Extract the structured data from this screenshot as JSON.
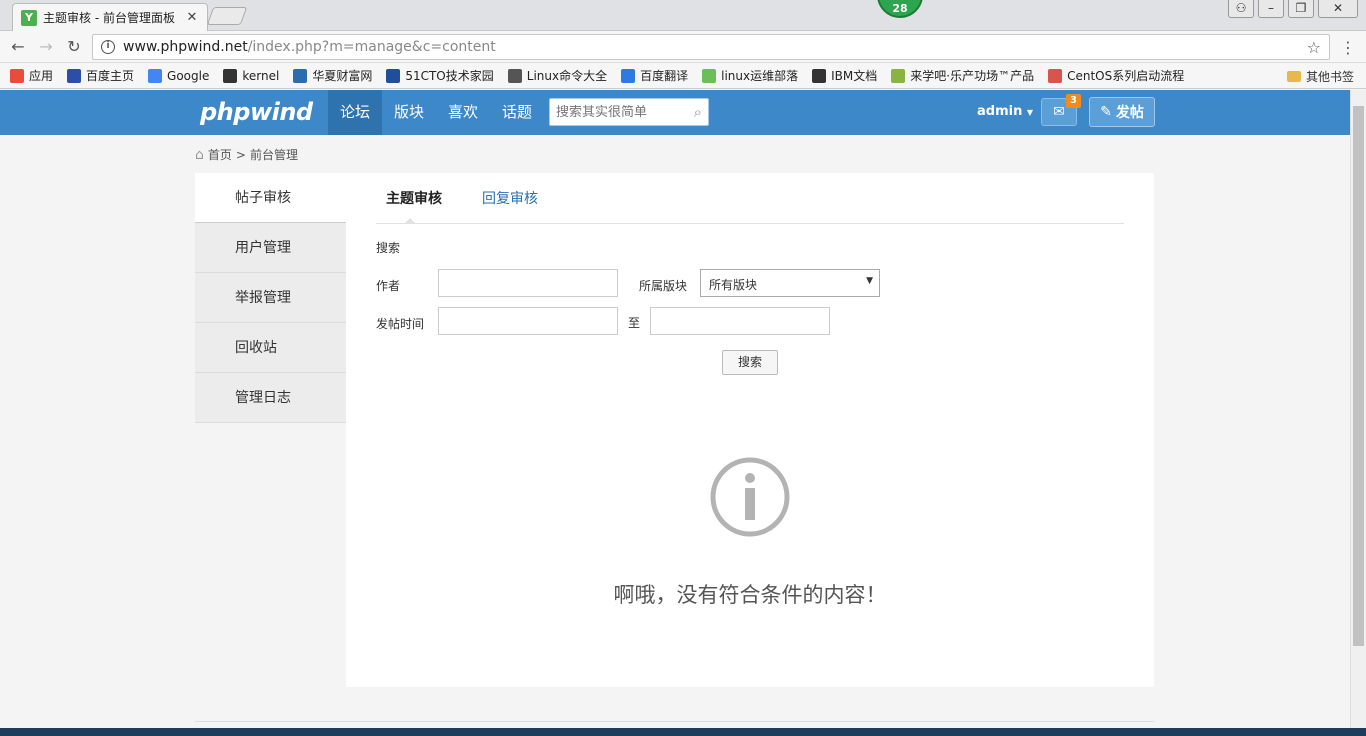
{
  "browser": {
    "tab_title": "主题审核 - 前台管理面板",
    "extension_badge": "28",
    "url_domain": "www.phpwind.net",
    "url_path": "/index.php?m=manage&c=content"
  },
  "bookmarks": [
    {
      "label": "应用",
      "color": "#e74c3c"
    },
    {
      "label": "百度主页",
      "color": "#2c4ea8"
    },
    {
      "label": "Google",
      "color": "#4285f4"
    },
    {
      "label": "kernel",
      "color": "#333333"
    },
    {
      "label": "华夏财富网",
      "color": "#2b6cb0"
    },
    {
      "label": "51CTO技术家园",
      "color": "#1f4e9a"
    },
    {
      "label": "Linux命令大全",
      "color": "#555555"
    },
    {
      "label": "百度翻译",
      "color": "#2c7be5"
    },
    {
      "label": "linux运维部落",
      "color": "#6bbf59"
    },
    {
      "label": "IBM文档",
      "color": "#333333"
    },
    {
      "label": "来学吧·乐产功场™产品",
      "color": "#8ab33f"
    },
    {
      "label": "CentOS系列启动流程",
      "color": "#d9534f"
    }
  ],
  "other_bookmarks": "其他书签",
  "header": {
    "logo": "phpwind",
    "nav": [
      "论坛",
      "版块",
      "喜欢",
      "话题"
    ],
    "search_placeholder": "搜索其实很简单",
    "user": "admin",
    "message_count": "3",
    "post_label": "发帖"
  },
  "breadcrumb": {
    "home": "首页",
    "current": "前台管理"
  },
  "sidebar": [
    "帖子审核",
    "用户管理",
    "举报管理",
    "回收站",
    "管理日志"
  ],
  "tabs": [
    "主题审核",
    "回复审核"
  ],
  "search_form": {
    "section": "搜索",
    "author_label": "作者",
    "author_value": "",
    "forum_label": "所属版块",
    "forum_value": "所有版块",
    "time_label": "发帖时间",
    "time_from": "",
    "to_label": "至",
    "time_to": "",
    "button": "搜索"
  },
  "empty_message": "啊哦，没有符合条件的内容！",
  "colors": {
    "header_bg": "#3d88c9",
    "nav_active": "#2f73ae",
    "badge": "#f08c1d",
    "link": "#2a6fb5"
  }
}
